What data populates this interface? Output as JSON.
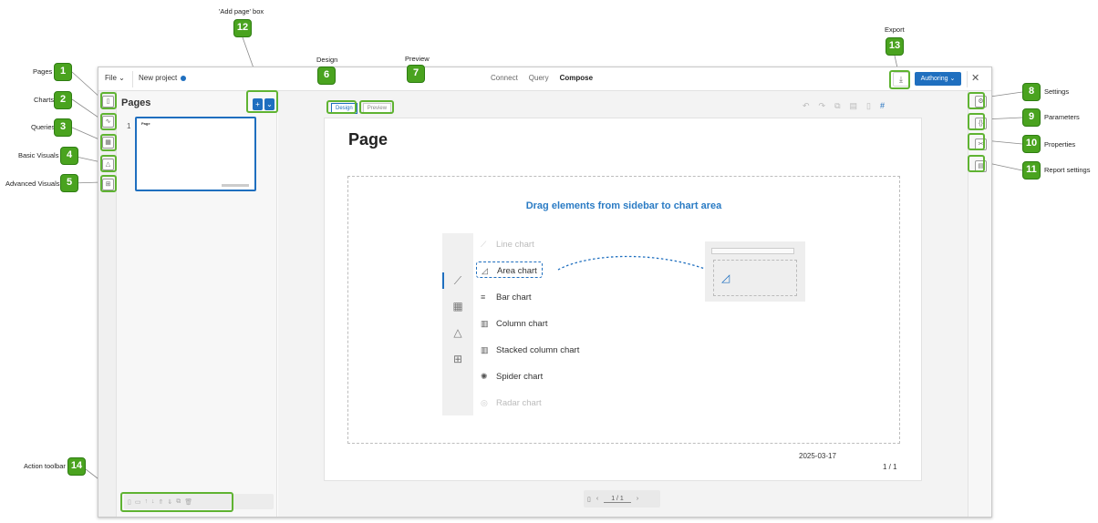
{
  "topbar": {
    "file_label": "File ⌄",
    "project_name": "New project",
    "nav": [
      "Connect",
      "Query",
      "Compose"
    ],
    "nav_active": "Compose",
    "export_icon": "download-icon",
    "authoring_label": "Authoring ⌄",
    "close_icon": "close-icon"
  },
  "pages_panel": {
    "title": "Pages",
    "add_button": "+",
    "add_menu": "⌄",
    "page_number": "1",
    "thumbnail_title": "Page"
  },
  "mode_tabs": {
    "design": "Design",
    "preview": "Preview"
  },
  "page": {
    "title": "Page",
    "drop_hint": "Drag elements from sidebar to chart area",
    "date": "2025-03-17",
    "page_counter": "1 / 1"
  },
  "demo_chart_list": [
    "Line chart",
    "Area chart",
    "Bar chart",
    "Column chart",
    "Stacked column chart",
    "Spider chart",
    "Radar chart"
  ],
  "bottom_pager": {
    "value": "1 / 1"
  },
  "callouts": {
    "c1": {
      "number": "1",
      "label": "Pages"
    },
    "c2": {
      "number": "2",
      "label": "Charts"
    },
    "c3": {
      "number": "3",
      "label": "Queries"
    },
    "c4": {
      "number": "4",
      "label": "Basic Visuals"
    },
    "c5": {
      "number": "5",
      "label": "Advanced Visuals"
    },
    "c6": {
      "number": "6",
      "label": "Design"
    },
    "c7": {
      "number": "7",
      "label": "Preview"
    },
    "c8": {
      "number": "8",
      "label": "Settings"
    },
    "c9": {
      "number": "9",
      "label": "Parameters"
    },
    "c10": {
      "number": "10",
      "label": "Properties"
    },
    "c11": {
      "number": "11",
      "label": "Report settings"
    },
    "c12": {
      "number": "12",
      "label": "'Add page' box"
    },
    "c13": {
      "number": "13",
      "label": "Export"
    },
    "c14": {
      "number": "14",
      "label": "Action toolbar"
    }
  },
  "colors": {
    "accent": "#1f6fbf",
    "callout_green": "#4aa31f"
  }
}
